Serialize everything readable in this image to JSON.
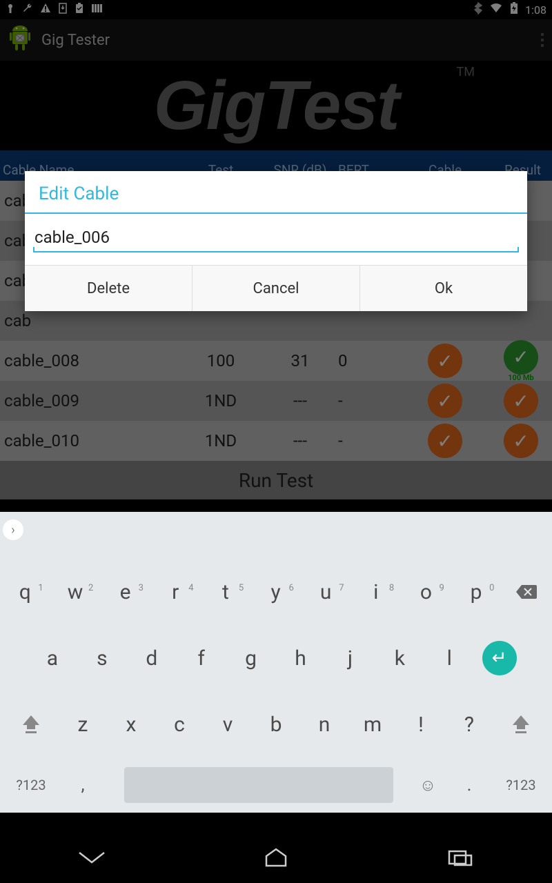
{
  "status": {
    "time": "1:08"
  },
  "app": {
    "title": "Gig Tester"
  },
  "banner": {
    "text": "GigTest",
    "tm": "TM"
  },
  "headers": {
    "name": "Cable Name",
    "test": "Test",
    "snr": "SNR (dB)",
    "bert": "BERT",
    "cable": "Cable",
    "result": "Result"
  },
  "rows": [
    {
      "name": "cable_008",
      "test": "100",
      "snr": "31",
      "bert": "0",
      "cable_badge": "orange",
      "result_badge": "green",
      "result_label": "100 Mb"
    },
    {
      "name": "cable_009",
      "test": "1ND",
      "snr": "---",
      "bert": "-",
      "cable_badge": "orange",
      "result_badge": "orange",
      "result_label": ""
    },
    {
      "name": "cable_010",
      "test": "1ND",
      "snr": "---",
      "bert": "-",
      "cable_badge": "orange",
      "result_badge": "orange",
      "result_label": ""
    }
  ],
  "partial_rows": [
    "cab",
    "cab",
    "cab",
    "cab"
  ],
  "run_test": "Run Test",
  "dialog": {
    "title": "Edit Cable",
    "value": "cable_006",
    "delete": "Delete",
    "cancel": "Cancel",
    "ok": "Ok"
  },
  "keyboard": {
    "row1": [
      {
        "k": "q",
        "h": "1"
      },
      {
        "k": "w",
        "h": "2"
      },
      {
        "k": "e",
        "h": "3"
      },
      {
        "k": "r",
        "h": "4"
      },
      {
        "k": "t",
        "h": "5"
      },
      {
        "k": "y",
        "h": "6"
      },
      {
        "k": "u",
        "h": "7"
      },
      {
        "k": "i",
        "h": "8"
      },
      {
        "k": "o",
        "h": "9"
      },
      {
        "k": "p",
        "h": "0"
      }
    ],
    "row2": [
      "a",
      "s",
      "d",
      "f",
      "g",
      "h",
      "j",
      "k",
      "l"
    ],
    "row3": [
      "z",
      "x",
      "c",
      "v",
      "b",
      "n",
      "m",
      "!",
      "?"
    ],
    "sym": "?123",
    "comma": ",",
    "dot": "."
  }
}
